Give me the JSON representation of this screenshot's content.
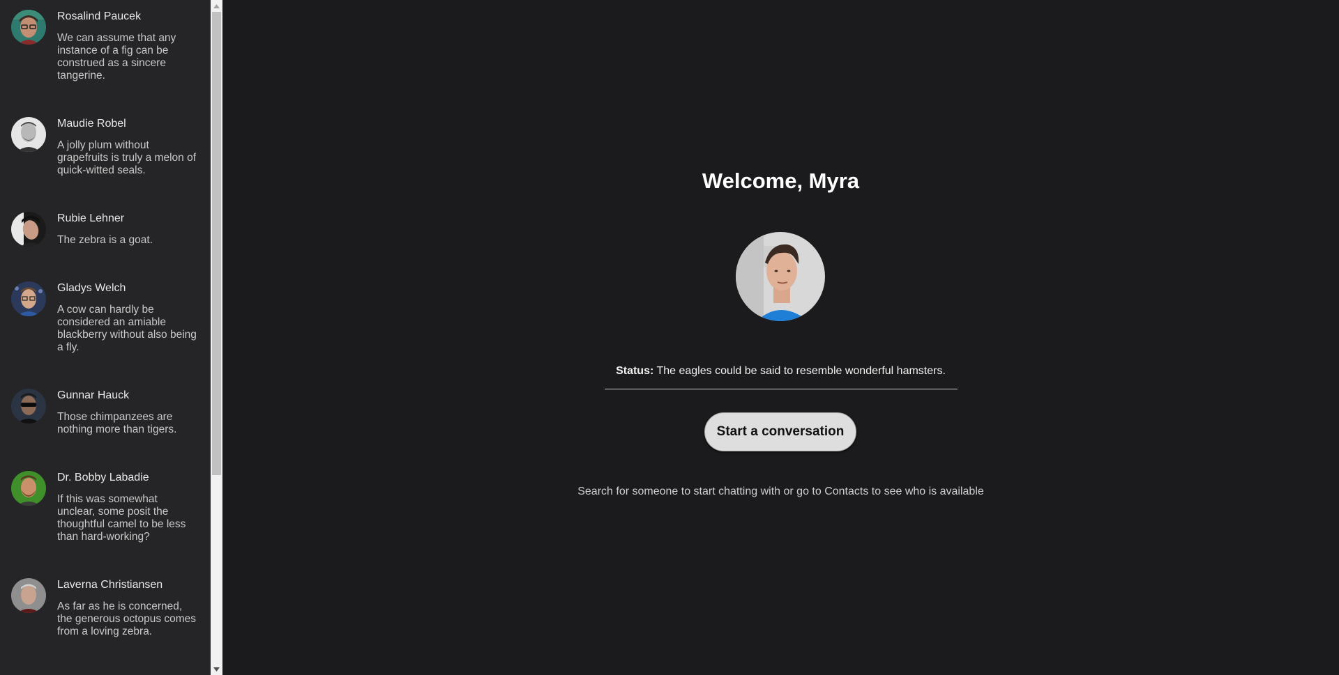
{
  "contacts": [
    {
      "name": "Rosalind Paucek",
      "status": "We can assume that any instance of a fig can be construed as a sincere tangerine."
    },
    {
      "name": "Maudie Robel",
      "status": "A jolly plum without grapefruits is truly a melon of quick-witted seals."
    },
    {
      "name": "Rubie Lehner",
      "status": "The zebra is a goat."
    },
    {
      "name": "Gladys Welch",
      "status": "A cow can hardly be considered an amiable blackberry without also being a fly."
    },
    {
      "name": "Gunnar Hauck",
      "status": "Those chimpanzees are nothing more than tigers."
    },
    {
      "name": "Dr. Bobby Labadie",
      "status": "If this was somewhat unclear, some posit the thoughtful camel to be less than hard-working?"
    },
    {
      "name": "Laverna Christiansen",
      "status": "As far as he is concerned, the generous octopus comes from a loving zebra."
    }
  ],
  "main": {
    "welcome": "Welcome, Myra",
    "status_label": "Status:",
    "status_text": "The eagles could be said to resemble wonderful hamsters.",
    "start_button": "Start a conversation",
    "hint": "Search for someone to start chatting with or go to Contacts to see who is available"
  },
  "colors": {
    "background": "#1b1b1d",
    "sidebar": "#252527",
    "button": "#dedede"
  }
}
